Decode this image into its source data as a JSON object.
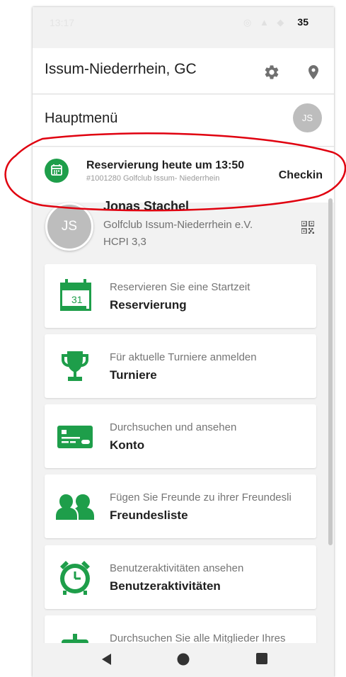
{
  "status_bar": {
    "time": "13:17",
    "battery": "35"
  },
  "app_bar": {
    "title": "Issum-Niederrhein, GC",
    "settings_icon": "gear-icon",
    "location_icon": "location-pin-icon"
  },
  "menu_header": {
    "title": "Hauptmenü",
    "avatar_initials": "JS"
  },
  "reservation_banner": {
    "title": "Reservierung heute um 13:50",
    "subtitle": "#1001280 Golfclub Issum- Niederrhein",
    "action": "Checkin"
  },
  "profile": {
    "initials": "JS",
    "name": "Jonas Stachel",
    "club": "Golfclub Issum-Niederrhein e.V.",
    "hcpi": "HCPI 3,3",
    "qr_icon": "qr-code-icon"
  },
  "menu_items": [
    {
      "subtitle": "Reservieren Sie eine Startzeit",
      "title": "Reservierung",
      "icon": "calendar-icon",
      "calendar_day": "31"
    },
    {
      "subtitle": "Für aktuelle Turniere anmelden",
      "title": "Turniere",
      "icon": "trophy-icon"
    },
    {
      "subtitle": "Durchsuchen und ansehen",
      "title": "Konto",
      "icon": "card-icon"
    },
    {
      "subtitle": "Fügen Sie Freunde zu ihrer Freundesli",
      "title": "Freundesliste",
      "icon": "friends-icon"
    },
    {
      "subtitle": "Benutzeraktivitäten ansehen",
      "title": "Benutzeraktivitäten",
      "icon": "alarm-clock-icon"
    },
    {
      "subtitle": "Durchsuchen Sie alle Mitglieder Ihres",
      "title": "",
      "icon": "members-icon"
    }
  ],
  "colors": {
    "accent_green": "#1e9e4a",
    "annotation_red": "#e0000f"
  }
}
